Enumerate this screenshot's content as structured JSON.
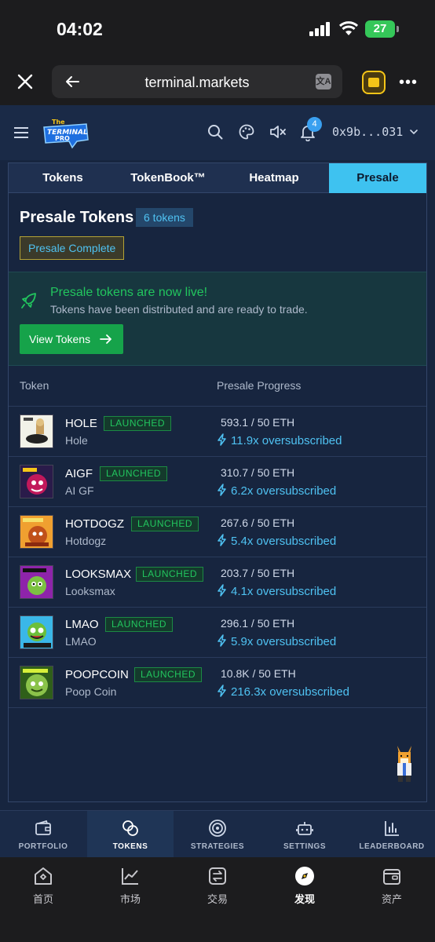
{
  "status_bar": {
    "time": "04:02",
    "battery": "27"
  },
  "browser": {
    "domain": "terminal.markets",
    "translate_glyph": "文A"
  },
  "header": {
    "notification_count": "4",
    "wallet": "0x9b...031",
    "logo_text": "The Terminal PRO"
  },
  "tabs": [
    {
      "label": "Tokens",
      "active": false
    },
    {
      "label": "TokenBook™",
      "active": false
    },
    {
      "label": "Heatmap",
      "active": false
    },
    {
      "label": "Presale",
      "active": true
    }
  ],
  "presale": {
    "title": "Presale Tokens",
    "count": "6 tokens",
    "status": "Presale Complete",
    "live_heading": "Presale tokens are now live!",
    "live_sub": "Tokens have been distributed and are ready to trade.",
    "view_button": "View Tokens"
  },
  "table": {
    "col_token": "Token",
    "col_progress": "Presale Progress",
    "rows": [
      {
        "symbol": "HOLE",
        "name": "Hole",
        "status": "LAUNCHED",
        "raised": "593.1 / 50 ETH",
        "oversub": "11.9x oversubscribed",
        "color": "#f2f2e8"
      },
      {
        "symbol": "AIGF",
        "name": "AI GF",
        "status": "LAUNCHED",
        "raised": "310.7 / 50 ETH",
        "oversub": "6.2x oversubscribed",
        "color": "#c2185b"
      },
      {
        "symbol": "HOTDOGZ",
        "name": "Hotdogz",
        "status": "LAUNCHED",
        "raised": "267.6 / 50 ETH",
        "oversub": "5.4x oversubscribed",
        "color": "#e8701a"
      },
      {
        "symbol": "LOOKSMAX",
        "name": "Looksmax",
        "status": "LAUNCHED",
        "raised": "203.7 / 50 ETH",
        "oversub": "4.1x oversubscribed",
        "color": "#8e24aa"
      },
      {
        "symbol": "LMAO",
        "name": "LMAO",
        "status": "LAUNCHED",
        "raised": "296.1 / 50 ETH",
        "oversub": "5.9x oversubscribed",
        "color": "#3ab7e8"
      },
      {
        "symbol": "POOPCOIN",
        "name": "Poop Coin",
        "status": "LAUNCHED",
        "raised": "10.8K / 50 ETH",
        "oversub": "216.3x oversubscribed",
        "color": "#5fa82a"
      }
    ]
  },
  "app_nav": [
    {
      "label": "PORTFOLIO",
      "icon": "wallet-icon",
      "active": false
    },
    {
      "label": "TOKENS",
      "icon": "coins-icon",
      "active": true
    },
    {
      "label": "STRATEGIES",
      "icon": "target-icon",
      "active": false
    },
    {
      "label": "SETTINGS",
      "icon": "robot-icon",
      "active": false
    },
    {
      "label": "LEADERBOARD",
      "icon": "bar-chart-icon",
      "active": false
    }
  ],
  "browser_nav": [
    {
      "label": "首页",
      "icon": "home-icon",
      "active": false
    },
    {
      "label": "市场",
      "icon": "market-icon",
      "active": false
    },
    {
      "label": "交易",
      "icon": "trade-icon",
      "active": false
    },
    {
      "label": "发现",
      "icon": "discover-icon",
      "active": true
    },
    {
      "label": "资产",
      "icon": "assets-icon",
      "active": false
    }
  ]
}
